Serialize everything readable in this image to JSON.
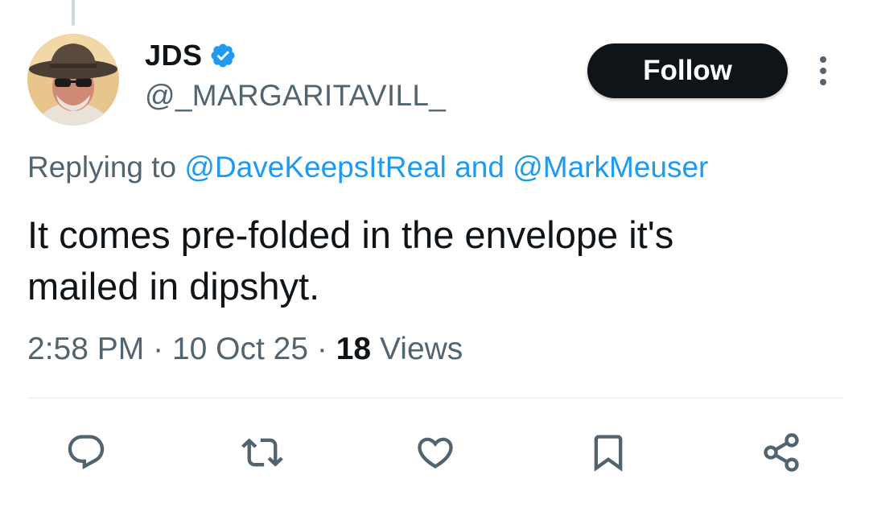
{
  "author": {
    "display_name": "JDS",
    "handle": "@_MARGARITAVILL_",
    "verified": true
  },
  "header": {
    "follow_label": "Follow"
  },
  "reply_context": {
    "prefix": "Replying to",
    "mention_1": "@DaveKeepsItReal",
    "joiner": "and",
    "mention_2": "@MarkMeuser"
  },
  "tweet": {
    "text_line_1": "It comes pre-folded in the envelope it's",
    "text_line_2": "mailed in dipshyt."
  },
  "meta": {
    "time": "2:58 PM",
    "date": "10 Oct 25",
    "views_count": "18",
    "views_label": "Views",
    "separator": "·"
  },
  "actions": {
    "icons": [
      "reply-icon",
      "retweet-icon",
      "like-icon",
      "bookmark-icon",
      "share-icon"
    ]
  },
  "colors": {
    "link_blue": "#1d9bf0",
    "muted_text": "#536471",
    "primary_text": "#0f1419",
    "icon_gray": "#536471",
    "divider": "#e6ecf0"
  }
}
